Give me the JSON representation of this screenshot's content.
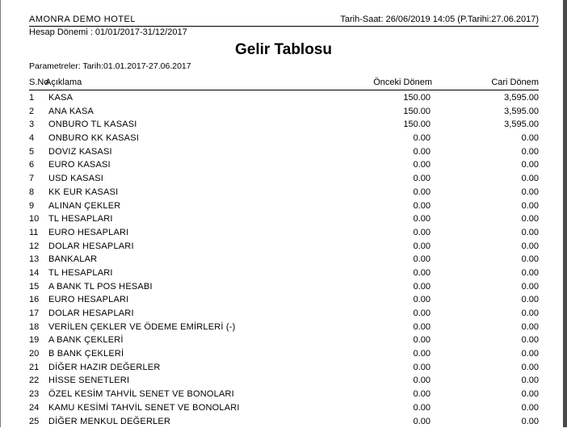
{
  "header": {
    "hotel": "AMONRA DEMO HOTEL",
    "period": "Hesap Dönemi : 01/01/2017-31/12/2017",
    "datetime": "Tarih-Saat: 26/06/2019 14:05 (P.Tarihi:27.06.2017)"
  },
  "title": "Gelir Tablosu",
  "parameters": "Parametreler: Tarih:01.01.2017-27.06.2017",
  "columns": {
    "no": "S.No",
    "desc": "Açıklama",
    "prev": "Önceki Dönem",
    "curr": "Cari Dönem"
  },
  "rows": [
    {
      "no": "1",
      "desc": "KASA",
      "prev": "150.00",
      "curr": "3,595.00"
    },
    {
      "no": "2",
      "desc": "ANA KASA",
      "prev": "150.00",
      "curr": "3,595.00"
    },
    {
      "no": "3",
      "desc": "ONBURO TL KASASI",
      "prev": "150.00",
      "curr": "3,595.00"
    },
    {
      "no": "4",
      "desc": "ONBURO KK KASASI",
      "prev": "0.00",
      "curr": "0.00"
    },
    {
      "no": "5",
      "desc": "DOVIZ KASASI",
      "prev": "0.00",
      "curr": "0.00"
    },
    {
      "no": "6",
      "desc": "EURO KASASI",
      "prev": "0.00",
      "curr": "0.00"
    },
    {
      "no": "7",
      "desc": "USD KASASI",
      "prev": "0.00",
      "curr": "0.00"
    },
    {
      "no": "8",
      "desc": "KK EUR KASASI",
      "prev": "0.00",
      "curr": "0.00"
    },
    {
      "no": "9",
      "desc": "ALINAN ÇEKLER",
      "prev": "0.00",
      "curr": "0.00"
    },
    {
      "no": "10",
      "desc": "TL HESAPLARI",
      "prev": "0.00",
      "curr": "0.00"
    },
    {
      "no": "11",
      "desc": "EURO HESAPLARI",
      "prev": "0.00",
      "curr": "0.00"
    },
    {
      "no": "12",
      "desc": "DOLAR HESAPLARI",
      "prev": "0.00",
      "curr": "0.00"
    },
    {
      "no": "13",
      "desc": "BANKALAR",
      "prev": "0.00",
      "curr": "0.00"
    },
    {
      "no": "14",
      "desc": "TL HESAPLARI",
      "prev": "0.00",
      "curr": "0.00"
    },
    {
      "no": "15",
      "desc": "A BANK TL POS HESABI",
      "prev": "0.00",
      "curr": "0.00"
    },
    {
      "no": "16",
      "desc": "EURO HESAPLARI",
      "prev": "0.00",
      "curr": "0.00"
    },
    {
      "no": "17",
      "desc": "DOLAR HESAPLARI",
      "prev": "0.00",
      "curr": "0.00"
    },
    {
      "no": "18",
      "desc": "VERİLEN ÇEKLER VE ÖDEME EMİRLERİ (-)",
      "prev": "0.00",
      "curr": "0.00"
    },
    {
      "no": "19",
      "desc": "A BANK ÇEKLERİ",
      "prev": "0.00",
      "curr": "0.00"
    },
    {
      "no": "20",
      "desc": "B BANK ÇEKLERİ",
      "prev": "0.00",
      "curr": "0.00"
    },
    {
      "no": "21",
      "desc": "DİĞER HAZIR DEĞERLER",
      "prev": "0.00",
      "curr": "0.00"
    },
    {
      "no": "22",
      "desc": "HİSSE SENETLERI",
      "prev": "0.00",
      "curr": "0.00"
    },
    {
      "no": "23",
      "desc": "ÖZEL KESİM TAHVİL SENET VE BONOLARI",
      "prev": "0.00",
      "curr": "0.00"
    },
    {
      "no": "24",
      "desc": "KAMU KESİMİ TAHVİL SENET VE BONOLARI",
      "prev": "0.00",
      "curr": "0.00"
    },
    {
      "no": "25",
      "desc": "DİĞER MENKUL DEĞERLER",
      "prev": "0.00",
      "curr": "0.00"
    }
  ]
}
